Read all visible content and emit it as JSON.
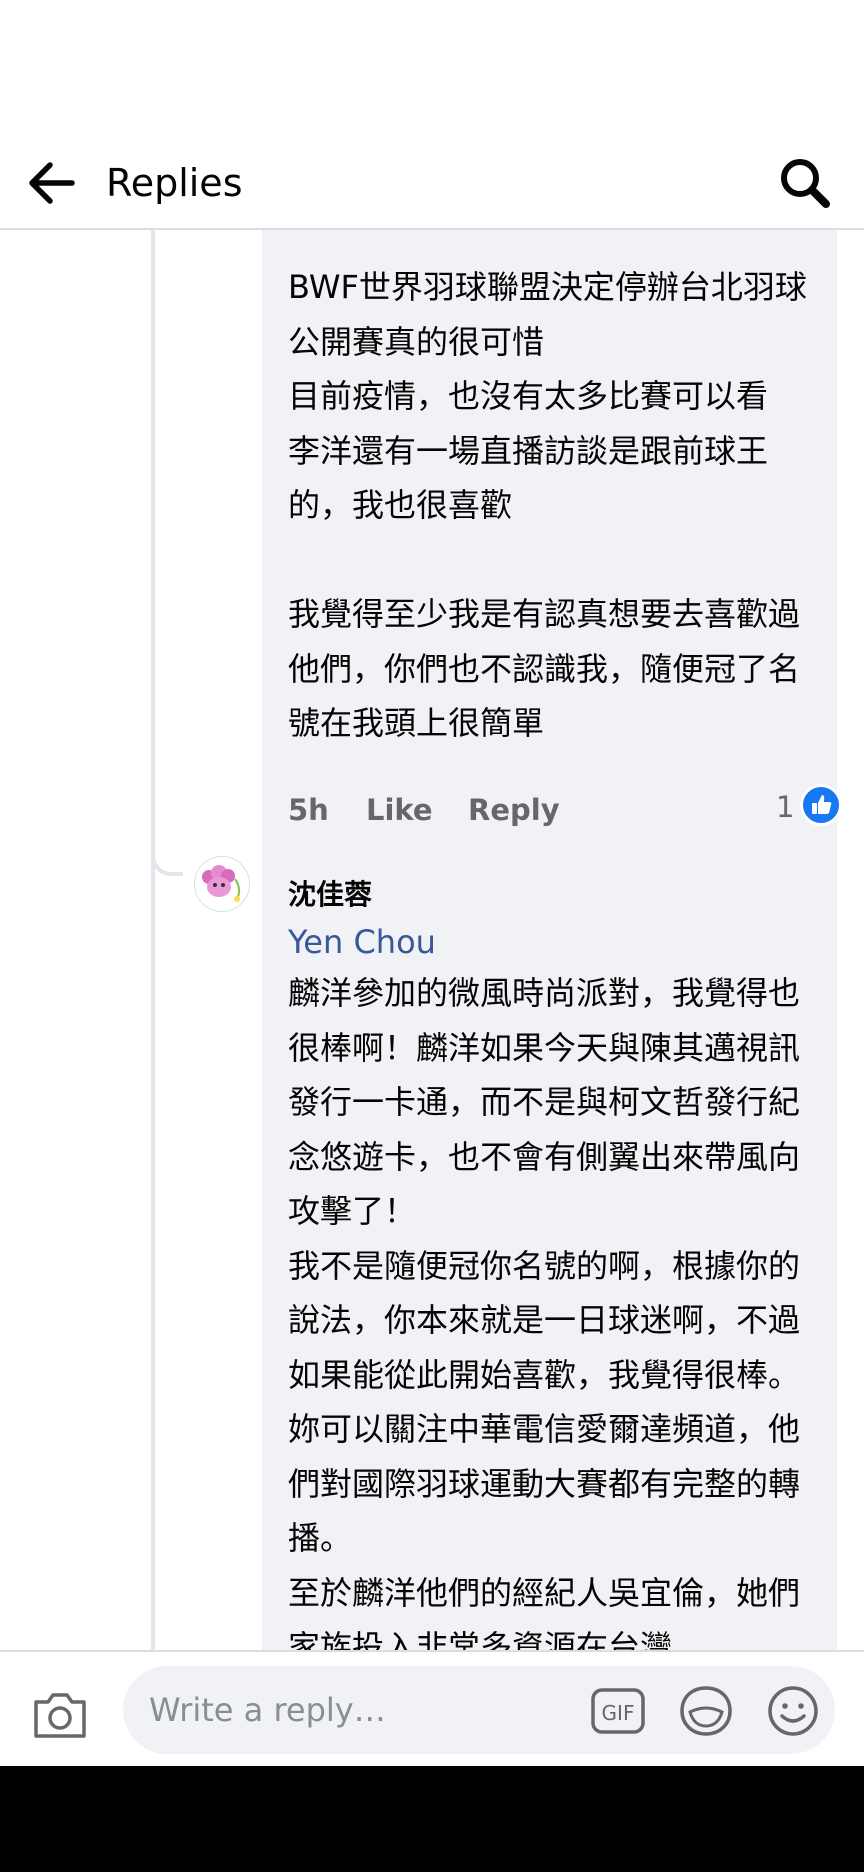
{
  "header": {
    "title": "Replies"
  },
  "comment1": {
    "text": "BWF世界羽球聯盟決定停辦台北羽球公開賽真的很可惜\n目前疫情，也沒有太多比賽可以看\n李洋還有一場直播訪談是跟前球王的，我也很喜歡\n\n我覺得至少我是有認真想要去喜歡過他們，你們也不認識我，隨便冠了名號在我頭上很簡單",
    "time": "5h",
    "like_label": "Like",
    "reply_label": "Reply",
    "like_count": "1"
  },
  "comment2": {
    "author": "沈佳蓉",
    "mention": "Yen Chou",
    "text": "麟洋參加的微風時尚派對，我覺得也很棒啊！麟洋如果今天與陳其邁視訊發行一卡通，而不是與柯文哲發行紀念悠遊卡，也不會有側翼出來帶風向攻擊了！\n我不是隨便冠你名號的啊，根據你的說法，你本來就是一日球迷啊，不過如果能從此開始喜歡，我覺得很棒。妳可以關注中華電信愛爾達頻道，他們對國際羽球運動大賽都有完整的轉播。\n至於麟洋他們的經紀人吳宜倫，她們家族投入非常多資源在台灣"
  },
  "composer": {
    "placeholder": "Write a reply…"
  },
  "icons": {
    "back": "arrow-left-icon",
    "search": "search-icon",
    "camera": "camera-icon",
    "gif": "gif-icon",
    "sticker": "sticker-icon",
    "emoji": "emoji-icon",
    "like": "thumbs-up-icon"
  },
  "colors": {
    "accent": "#1877f2",
    "link": "#385898",
    "bubble": "#f0f2f5",
    "meta": "#65676b"
  }
}
